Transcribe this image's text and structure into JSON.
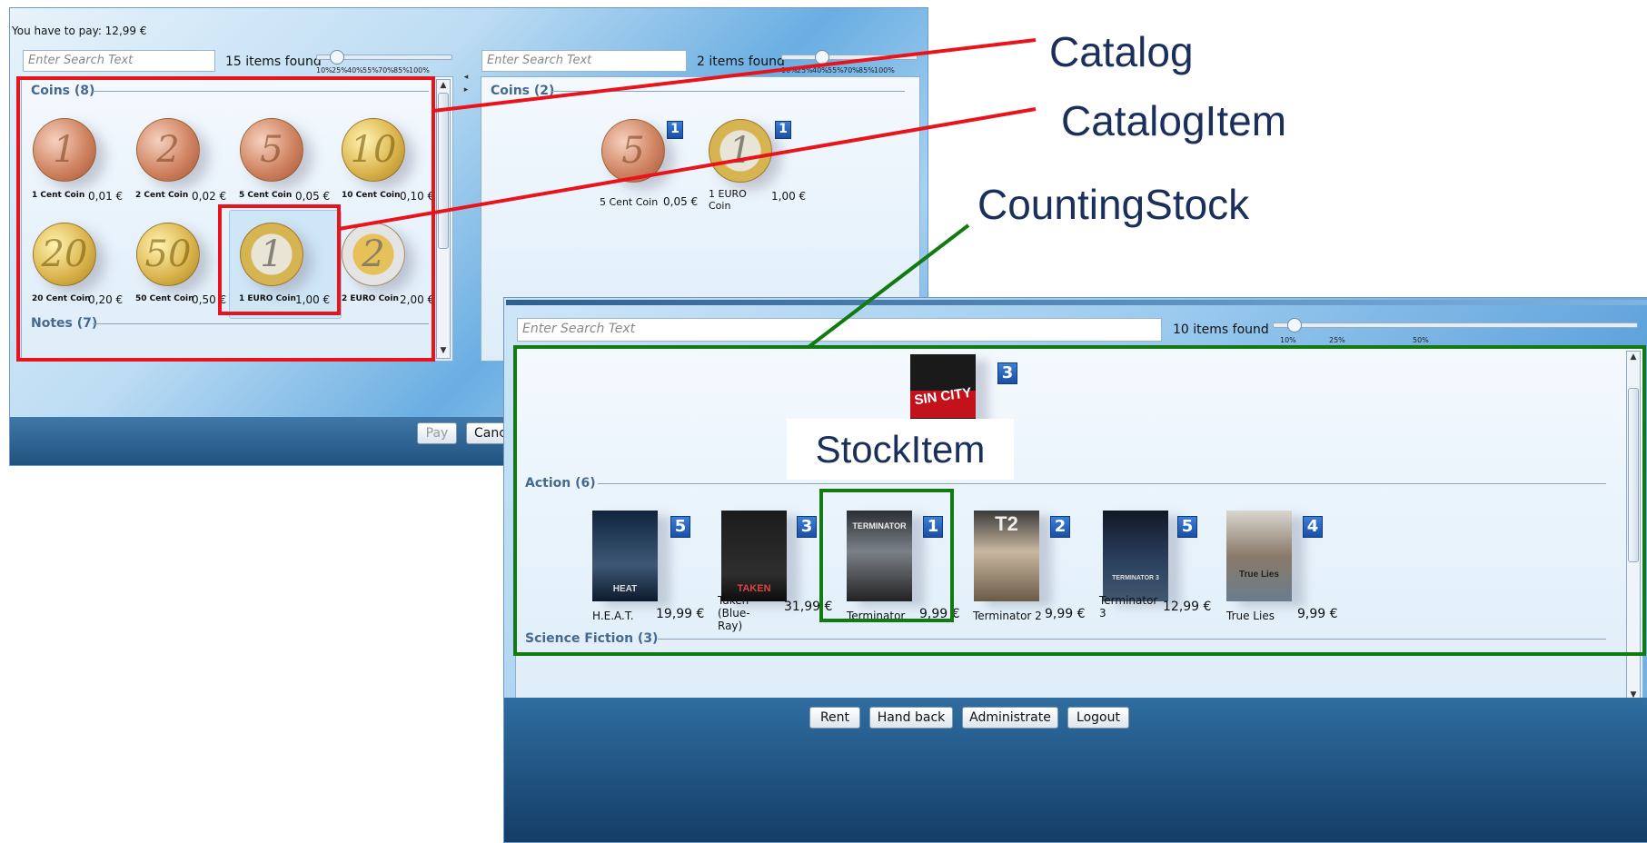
{
  "payment": {
    "amount_text": "You have to pay: 12,99 €",
    "catalog": {
      "search_placeholder": "Enter Search Text",
      "items_found": "15 items found",
      "ticks": [
        "10%",
        "25%",
        "40%",
        "55%",
        "70%",
        "85%",
        "100%"
      ],
      "zoom": 0.1,
      "groups": [
        {
          "title": "Coins (8)"
        },
        {
          "title": "Notes (7)"
        }
      ],
      "coins": [
        {
          "label": "1 Cent Coin",
          "price": "0,01 €",
          "face": "1"
        },
        {
          "label": "2 Cent Coin",
          "price": "0,02 €",
          "face": "2"
        },
        {
          "label": "5 Cent Coin",
          "price": "0,05 €",
          "face": "5"
        },
        {
          "label": "10 Cent Coin",
          "price": "0,10 €",
          "face": "10"
        },
        {
          "label": "20 Cent Coin",
          "price": "0,20 €",
          "face": "20"
        },
        {
          "label": "50 Cent Coin",
          "price": "0,50 €",
          "face": "50"
        },
        {
          "label": "1 EURO Coin",
          "price": "1,00 €",
          "face": "1"
        },
        {
          "label": "2 EURO Coin",
          "price": "2,00 €",
          "face": "2"
        }
      ]
    },
    "selected": {
      "search_placeholder": "Enter Search Text",
      "items_found": "2 items found",
      "ticks": [
        "10%",
        "25%",
        "40%",
        "55%",
        "70%",
        "85%",
        "100%"
      ],
      "zoom": 0.25,
      "group_title": "Coins (2)",
      "coins": [
        {
          "label": "5 Cent Coin",
          "price": "0,05 €",
          "count": "1",
          "face": "5"
        },
        {
          "label": "1 EURO Coin",
          "price": "1,00 €",
          "count": "1",
          "face": "1"
        }
      ]
    },
    "buttons": {
      "pay": "Pay",
      "cancel": "Canc"
    }
  },
  "rental": {
    "search_placeholder": "Enter Search Text",
    "items_found": "10 items found",
    "ticks": [
      "10%",
      "25%",
      "50%"
    ],
    "zoom": 0.1,
    "top_item": {
      "poster_title": "SIN CITY",
      "count": "3"
    },
    "groups": [
      {
        "title": "Action (6)"
      },
      {
        "title": "Science Fiction (3)"
      }
    ],
    "movies": [
      {
        "label": "H.E.A.T.",
        "price": "19,99 €",
        "count": "5",
        "poster_title": "HEAT"
      },
      {
        "label": "Taken (Blue-Ray)",
        "price": "31,99 €",
        "count": "3",
        "poster_title": "TAKEN"
      },
      {
        "label": "Terminator",
        "price": "9,99 €",
        "count": "1",
        "poster_title": "TERMINATOR"
      },
      {
        "label": "Terminator 2",
        "price": "9,99 €",
        "count": "2",
        "poster_title": "T2"
      },
      {
        "label": "Terminator 3",
        "price": "12,99 €",
        "count": "5",
        "poster_title": "TERMINATOR 3"
      },
      {
        "label": "True Lies",
        "price": "9,99 €",
        "count": "4",
        "poster_title": "True Lies"
      }
    ],
    "buttons": {
      "rent": "Rent",
      "hand_back": "Hand back",
      "administrate": "Administrate",
      "logout": "Logout"
    }
  },
  "annotations": {
    "catalog": "Catalog",
    "catalog_item": "CatalogItem",
    "counting_stock": "CountingStock",
    "stock_item": "StockItem"
  },
  "colors": {
    "catalog_highlight": "#e8131b",
    "stock_highlight": "#117a11",
    "badge": "#2260b8",
    "group_title": "#46698e"
  }
}
